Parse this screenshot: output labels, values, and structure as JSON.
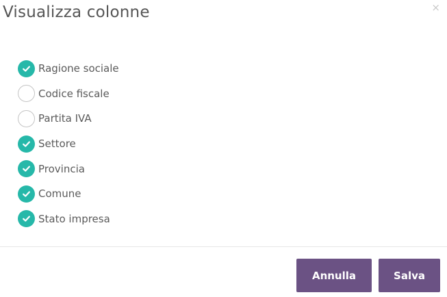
{
  "dialog": {
    "title": "Visualizza colonne",
    "close_symbol": "×",
    "close_icon": "close-icon"
  },
  "options": [
    {
      "label": "Ragione sociale",
      "checked": true
    },
    {
      "label": "Codice fiscale",
      "checked": false
    },
    {
      "label": "Partita IVA",
      "checked": false
    },
    {
      "label": "Settore",
      "checked": true
    },
    {
      "label": "Provincia",
      "checked": true
    },
    {
      "label": "Comune",
      "checked": true
    },
    {
      "label": "Stato impresa",
      "checked": true
    }
  ],
  "footer": {
    "cancel_label": "Annulla",
    "save_label": "Salva"
  },
  "colors": {
    "checked": "#26b8a9",
    "button": "#6b5284"
  }
}
